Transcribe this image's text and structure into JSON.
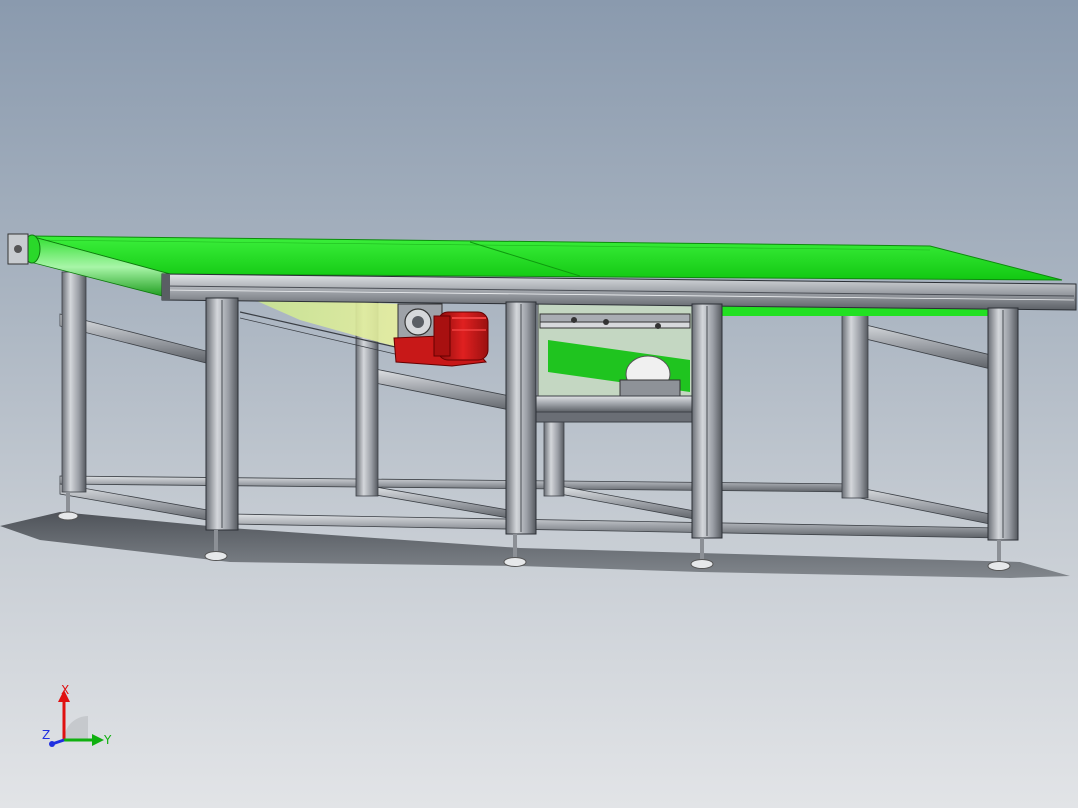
{
  "viewport": {
    "title": "",
    "colors": {
      "belt": "#22e022",
      "frame": "#b8bcc2",
      "frame_dark": "#4a4e55",
      "motor": "#d01818",
      "roller": "#e8e8e8"
    }
  },
  "triad": {
    "x_label": "X",
    "y_label": "Y",
    "z_label": "Z",
    "x_color": "#e01010",
    "y_color": "#10b010",
    "z_color": "#2030e0"
  }
}
